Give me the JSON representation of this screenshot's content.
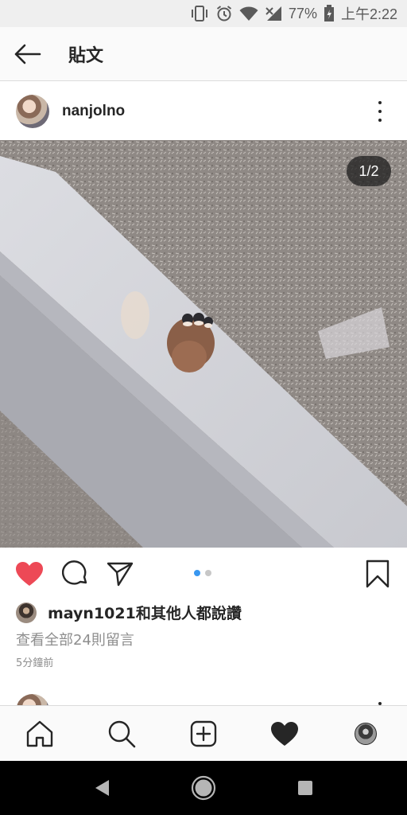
{
  "status_bar": {
    "battery": "77%",
    "time": "上午2:22",
    "icons": [
      "vibrate-icon",
      "alarm-icon",
      "wifi-icon",
      "signal-icon",
      "battery-icon"
    ]
  },
  "header": {
    "title": "貼文",
    "back_icon": "arrow-left-icon"
  },
  "post": {
    "username": "nanjolno",
    "page_indicator": "1/2",
    "carousel": {
      "current": 1,
      "total": 2,
      "active_color": "#3897f0",
      "inactive_color": "#c7c7c7"
    },
    "liked": true,
    "like_color": "#ed4956",
    "likes_text": "mayn1021和其他人都說讚",
    "comments_link": "查看全部24則留言",
    "timestamp": "5分鐘前"
  },
  "tabbar": {
    "items": [
      "home-icon",
      "search-icon",
      "add-post-icon",
      "activity-heart-icon",
      "profile-avatar"
    ]
  },
  "navbar": {
    "items": [
      "back-triangle-icon",
      "home-circle-icon",
      "recents-square-icon"
    ]
  }
}
